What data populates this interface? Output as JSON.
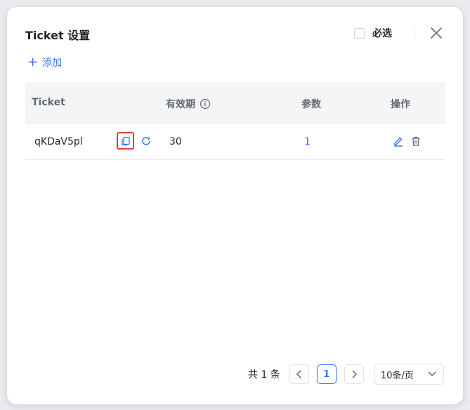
{
  "dialog": {
    "title": "Ticket 设置",
    "required_label": "必选",
    "required_checked": false,
    "add_label": "添加"
  },
  "table": {
    "columns": [
      "Ticket",
      "有效期",
      "参数",
      "操作"
    ],
    "rows": [
      {
        "ticket": "qKDaV5pl",
        "validity": "30",
        "params": "1"
      }
    ]
  },
  "pagination": {
    "total_text": "共 1 条",
    "current_page": "1",
    "page_size": "10条/页"
  },
  "icons": [
    "close-icon",
    "plus-icon",
    "info-icon",
    "copy-icon",
    "refresh-icon",
    "edit-icon",
    "delete-icon",
    "chevron-left-icon",
    "chevron-right-icon",
    "chevron-down-icon"
  ],
  "colors": {
    "accent": "#3370ff",
    "highlight": "#e23c3c"
  }
}
